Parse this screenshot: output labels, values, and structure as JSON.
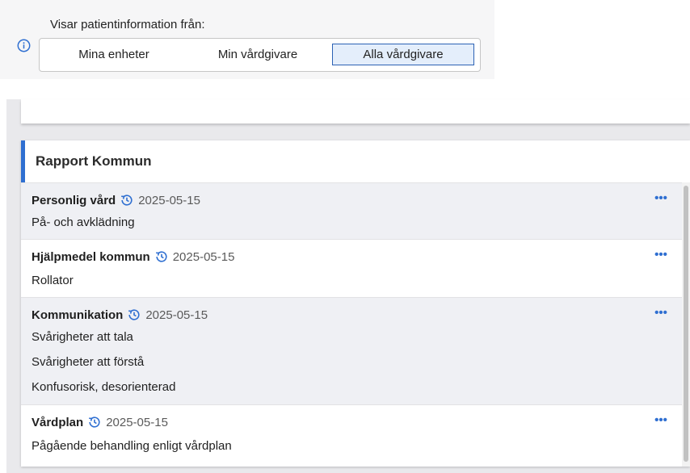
{
  "filter": {
    "label": "Visar patientinformation från:",
    "options": [
      "Mina enheter",
      "Min vårdgivare",
      "Alla vårdgivare"
    ],
    "selected": "Alla vårdgivare",
    "info_icon": "info-circle-icon"
  },
  "report": {
    "title": "Rapport Kommun",
    "accent_color": "#2f6fd1",
    "more_label": "•••",
    "history_icon": "history-clock-icon",
    "items": [
      {
        "title": "Personlig vård",
        "date": "2025-05-15",
        "lines": [
          "På- och avklädning"
        ]
      },
      {
        "title": "Hjälpmedel kommun",
        "date": "2025-05-15",
        "lines": [
          "Rollator"
        ]
      },
      {
        "title": "Kommunikation",
        "date": "2025-05-15",
        "lines": [
          "Svårigheter att tala",
          "Svårigheter att förstå",
          "Konfusorisk, desorienterad"
        ]
      },
      {
        "title": "Vårdplan",
        "date": "2025-05-15",
        "lines": [
          "Pågående behandling enligt vårdplan"
        ]
      }
    ]
  }
}
